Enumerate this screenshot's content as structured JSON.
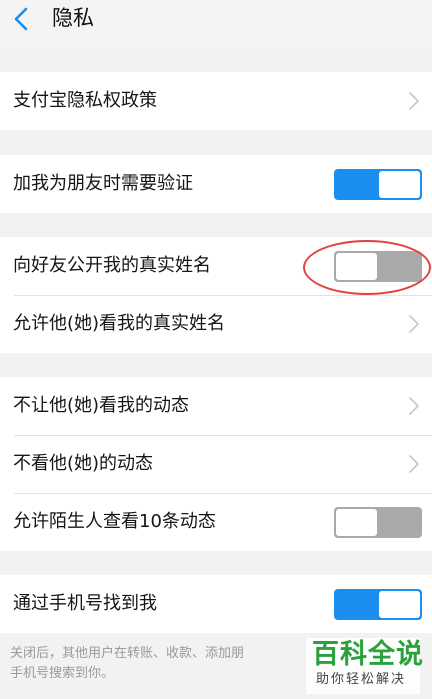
{
  "header": {
    "title": "隐私",
    "back_icon": "chevron-left-icon",
    "accent": "#1a8ff0"
  },
  "sections": [
    {
      "rows": [
        {
          "label": "支付宝隐私权政策",
          "control": "chevron"
        }
      ]
    },
    {
      "rows": [
        {
          "label": "加我为朋友时需要验证",
          "control": "toggle",
          "on": true
        }
      ]
    },
    {
      "rows": [
        {
          "label": "向好友公开我的真实姓名",
          "control": "toggle",
          "on": false,
          "highlighted": true
        },
        {
          "label": "允许他(她)看我的真实姓名",
          "control": "chevron"
        }
      ]
    },
    {
      "rows": [
        {
          "label": "不让他(她)看我的动态",
          "control": "chevron"
        },
        {
          "label": "不看他(她)的动态",
          "control": "chevron"
        },
        {
          "label": "允许陌生人查看10条动态",
          "control": "toggle",
          "on": false
        }
      ]
    },
    {
      "rows": [
        {
          "label": "通过手机号找到我",
          "control": "toggle",
          "on": true
        }
      ]
    }
  ],
  "footnote": {
    "line1": "关闭后，其他用户在转账、收款、添加朋",
    "line2": "手机号搜索到你。"
  },
  "watermark": {
    "title": "百科全说",
    "subtitle": "助你轻松解决",
    "color": "#2aa23c"
  },
  "colors": {
    "toggle_on": "#1a8ff0",
    "toggle_off": "#a9a9a9",
    "highlight_ring": "#e0433f",
    "background": "#f2f2f2"
  }
}
